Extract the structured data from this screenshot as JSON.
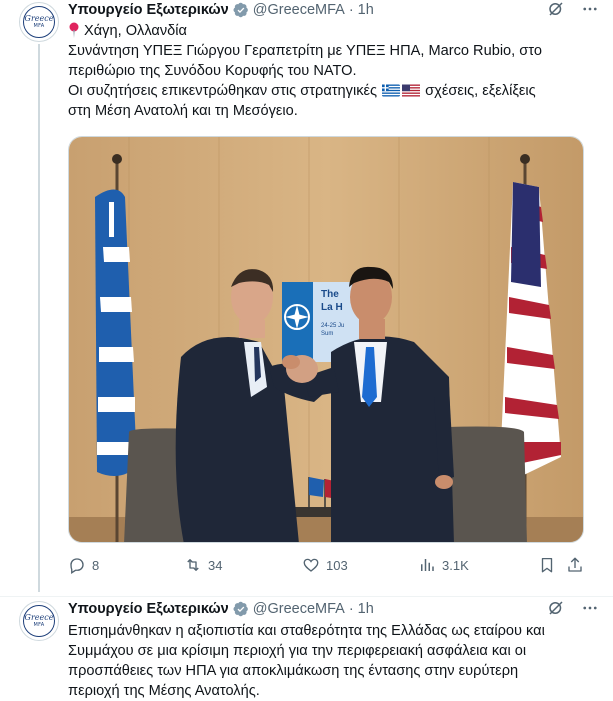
{
  "tweets": [
    {
      "author_name": "Υπουργείο Εξωτερικών",
      "handle": "@GreeceMFA",
      "separator": "·",
      "time": "1h",
      "avatar_text_1": "Greece",
      "avatar_text_2": "MFA",
      "location_line": "Χάγη, Ολλανδία",
      "body_lines": [
        "Συνάντηση ΥΠΕΞ Γιώργου Γεραπετρίτη με ΥΠΕΞ ΗΠΑ, Marco Rubio, στο",
        "περιθώριο της Συνόδου Κορυφής του ΝΑΤΟ.",
        "Οι συζητήσεις επικεντρώθηκαν στις στρατηγικές",
        "σχέσεις, εξελίξεις",
        "στη Μέση Ανατολή και τη Μεσόγειο."
      ],
      "photo": {
        "banner_line1": "The",
        "banner_line2": "La H",
        "banner_line3": "24-25 Ju",
        "banner_line4": "Sum"
      },
      "actions": {
        "replies": "8",
        "reposts": "34",
        "likes": "103",
        "views": "3.1K"
      }
    },
    {
      "author_name": "Υπουργείο Εξωτερικών",
      "handle": "@GreeceMFA",
      "separator": "·",
      "time": "1h",
      "avatar_text_1": "Greece",
      "avatar_text_2": "MFA",
      "body_lines": [
        "Επισημάνθηκαν η αξιοπιστία και σταθερότητα της Ελλάδας ως εταίρου και",
        "Συμμάχου σε μια κρίσιμη περιοχή για την περιφερειακή ασφάλεια και οι",
        "προσπάθειες των ΗΠΑ για αποκλιμάκωση της έντασης στην ευρύτερη",
        "περιοχή της Μέσης Ανατολής."
      ]
    }
  ],
  "colors": {
    "text": "#0f1419",
    "secondary": "#536471",
    "verified": "#829aab",
    "divider": "#eff3f4"
  },
  "icons": [
    "verified-badge-icon",
    "grok-icon",
    "more-icon",
    "pin-icon",
    "greek-flag-icon",
    "us-flag-icon",
    "reply-icon",
    "repost-icon",
    "like-icon",
    "views-icon",
    "bookmark-icon",
    "share-icon"
  ]
}
